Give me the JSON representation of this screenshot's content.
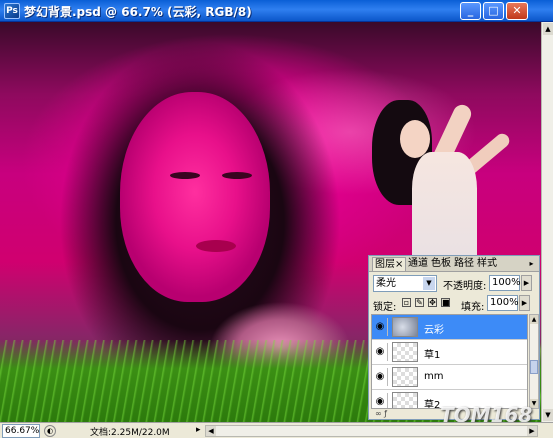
{
  "window": {
    "title": "梦幻背景.psd @ 66.7% (云彩, RGB/8)",
    "app_icon": "Ps",
    "min_label": "_",
    "max_label": "□",
    "close_label": "✕"
  },
  "panel": {
    "tabs": [
      "图层",
      "通道",
      "色板",
      "路径",
      "样式"
    ],
    "tab_close": "×",
    "menu_icon": "▸",
    "blend_mode": "柔光",
    "opacity_label": "不透明度:",
    "opacity_value": "100%",
    "lock_label": "锁定:",
    "fill_label": "填充:",
    "fill_value": "100%",
    "layers": [
      {
        "name": "云彩",
        "selected": true
      },
      {
        "name": "草1",
        "selected": false
      },
      {
        "name": "mm",
        "selected": false
      },
      {
        "name": "草2",
        "selected": false
      }
    ],
    "footer_icons": "∞ ƒ"
  },
  "status": {
    "zoom": "66.67%",
    "doc_text": "文档:2.25M/22.0M",
    "arrow": "▸"
  },
  "watermark": "TOM168",
  "colors": {
    "selected_layer": "#3d8bf7",
    "titlebar": "#0a5fd6"
  }
}
